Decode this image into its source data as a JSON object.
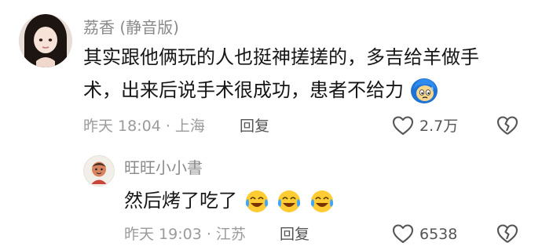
{
  "comment": {
    "username": "荔香 (静音版)",
    "text_line1": "其实跟他俩玩的人也挺神搓搓的，多吉给羊做手",
    "text_line2": "术，出来后说手术很成功，患者不给力",
    "emoji_icon": "anime-girl-sweat-emoji",
    "meta": "昨天 18:04 · 上海",
    "reply_label": "回复",
    "like_count": "2.7万"
  },
  "reply": {
    "username": "旺旺小小書",
    "text": "然后烤了吃了",
    "emoji_icon": "tears-of-joy-emoji",
    "emoji_count": 3,
    "meta": "昨天 19:03 · 江苏",
    "reply_label": "回复",
    "like_count": "6538"
  },
  "colors": {
    "text": "#161616",
    "meta": "#9b9b9b",
    "username": "#8a8a8a",
    "icon": "#555555"
  }
}
